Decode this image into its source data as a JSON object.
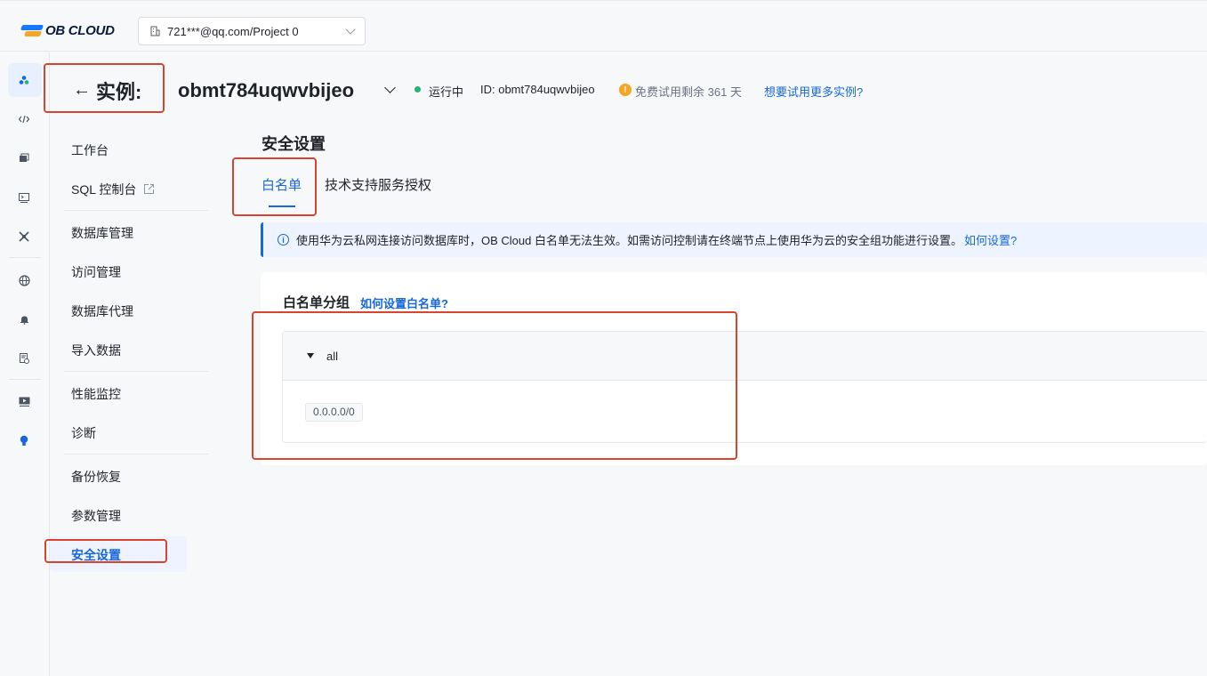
{
  "header": {
    "logo_text": "OB CLOUD",
    "project_selector": "721***@qq.com/Project 0"
  },
  "instance": {
    "page_title": "实例:",
    "name": "obmt784uqwvbijeo",
    "status": "运行中",
    "id_text": "ID: obmt784uqwvbijeo",
    "trial_text": "免费试用剩余 361 天",
    "trial_link": "想要试用更多实例?"
  },
  "sidebar": {
    "items": [
      {
        "label": "工作台"
      },
      {
        "label": "SQL 控制台"
      },
      {
        "label": "数据库管理"
      },
      {
        "label": "访问管理"
      },
      {
        "label": "数据库代理"
      },
      {
        "label": "导入数据"
      },
      {
        "label": "性能监控"
      },
      {
        "label": "诊断"
      },
      {
        "label": "备份恢复"
      },
      {
        "label": "参数管理"
      },
      {
        "label": "安全设置"
      }
    ]
  },
  "security": {
    "title": "安全设置",
    "tabs": [
      {
        "label": "白名单"
      },
      {
        "label": "技术支持服务授权"
      }
    ],
    "notice": "使用华为云私网连接访问数据库时，OB Cloud 白名单无法生效。如需访问控制请在终端节点上使用华为云的安全组功能进行设置。",
    "notice_link": "如何设置?",
    "whitelist": {
      "title": "白名单分组",
      "help_link": "如何设置白名单?",
      "groups": [
        {
          "name": "all",
          "ips": [
            "0.0.0.0/0"
          ]
        }
      ]
    }
  },
  "colors": {
    "accent": "#1668dc",
    "status_running": "#22b573",
    "trial_warning": "#f5a623",
    "annotation_red": "#d9442f"
  }
}
